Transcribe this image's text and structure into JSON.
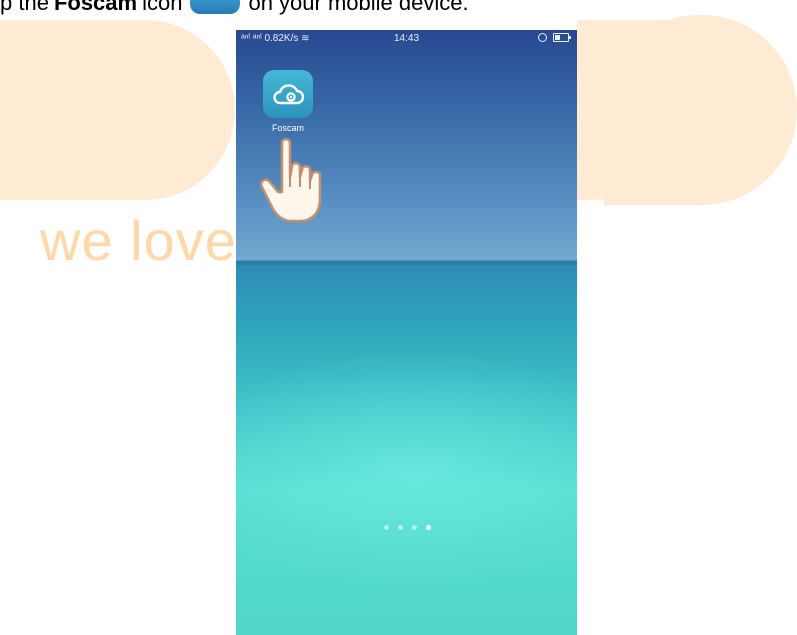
{
  "instruction": {
    "prefix": "p the",
    "app_name": "Foscam",
    "middle": "icon",
    "suffix": "on your mobile device."
  },
  "watermark": {
    "tagline": "we love smart"
  },
  "phone": {
    "status_bar": {
      "signal_text": "ᵃⁿˡ ᵃⁿˡ 0.82K/s ≋",
      "time": "14:43"
    },
    "home_screen": {
      "apps": [
        {
          "label": "Foscam",
          "icon": "cloud-eye-icon"
        }
      ],
      "page_indicator": {
        "total": 4,
        "active_index": 3
      }
    }
  },
  "colors": {
    "app_icon": "#3aa8cf",
    "watermark": "#ffd7a8",
    "wallpaper_top": "#2c4f9c",
    "wallpaper_bottom": "#4fd6c6"
  }
}
